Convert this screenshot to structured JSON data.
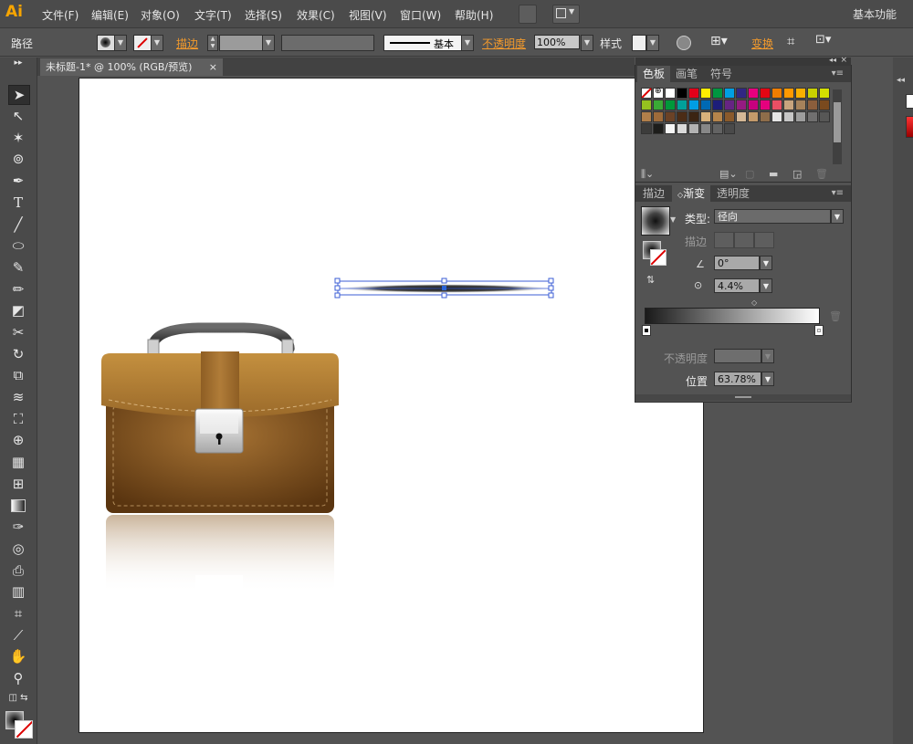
{
  "app": {
    "logo": "Ai"
  },
  "menu": {
    "items": [
      "文件(F)",
      "编辑(E)",
      "对象(O)",
      "文字(T)",
      "选择(S)",
      "效果(C)",
      "视图(V)",
      "窗口(W)",
      "帮助(H)"
    ],
    "workspace": "基本功能"
  },
  "control_bar": {
    "object_type": "路径",
    "stroke_label": "描边",
    "brush_style": "基本",
    "opacity_label": "不透明度",
    "opacity_value": "100%",
    "style_label": "样式",
    "transform_label": "变换"
  },
  "document": {
    "tab_title": "未标题-1* @ 100% (RGB/预览)",
    "close": "×"
  },
  "swatches_panel": {
    "tabs": [
      "色板",
      "画笔",
      "符号"
    ],
    "colors": [
      "#ffffff",
      "#000000",
      "#e2001a",
      "#ffed00",
      "#009640",
      "#009fe3",
      "#312783",
      "#e6007e",
      "#e30613",
      "#f07d00",
      "#ff9900",
      "#f9b000",
      "#c9d200",
      "#d4e000",
      "#95c11f",
      "#3aaa35",
      "#00983a",
      "#00a19a",
      "#009ee3",
      "#0069b4",
      "#1d1d7a",
      "#662483",
      "#951b81",
      "#c7007e",
      "#e6007e",
      "#e94f64",
      "#c8a47e",
      "#a6825b",
      "#8b5e3c",
      "#7a4a1e",
      "#b17f4a",
      "#9e6b3a",
      "#6b4226",
      "#4b2c16",
      "#3b2412",
      "#d9b27c",
      "#b5854b",
      "#8a5a2b",
      "#d4b896",
      "#c39a6b",
      "#8e6d4a",
      "#e5e5e5",
      "#c6c6c6",
      "#9d9d9d",
      "#706f6f",
      "#575756",
      "#3c3c3b",
      "#1d1d1b",
      "#f6f6f6",
      "#dadada",
      "#b2b2b2",
      "#878787",
      "#636363",
      "#4a4a4a"
    ]
  },
  "gradient_panel": {
    "tabs": [
      "描边",
      "渐变",
      "透明度"
    ],
    "type_label": "类型:",
    "type_value": "径向",
    "stroke_label": "描边",
    "angle_value": "0°",
    "aspect_value": "4.4%",
    "opacity_label": "不透明度",
    "position_label": "位置",
    "position_value": "63.78%",
    "gradient_start": "#1a1a1a",
    "gradient_end": "#ffffff"
  },
  "colors": {
    "accent_orange": "#f39a2c",
    "bag_brown": "#8a5a22",
    "bag_light": "#c4903f"
  }
}
